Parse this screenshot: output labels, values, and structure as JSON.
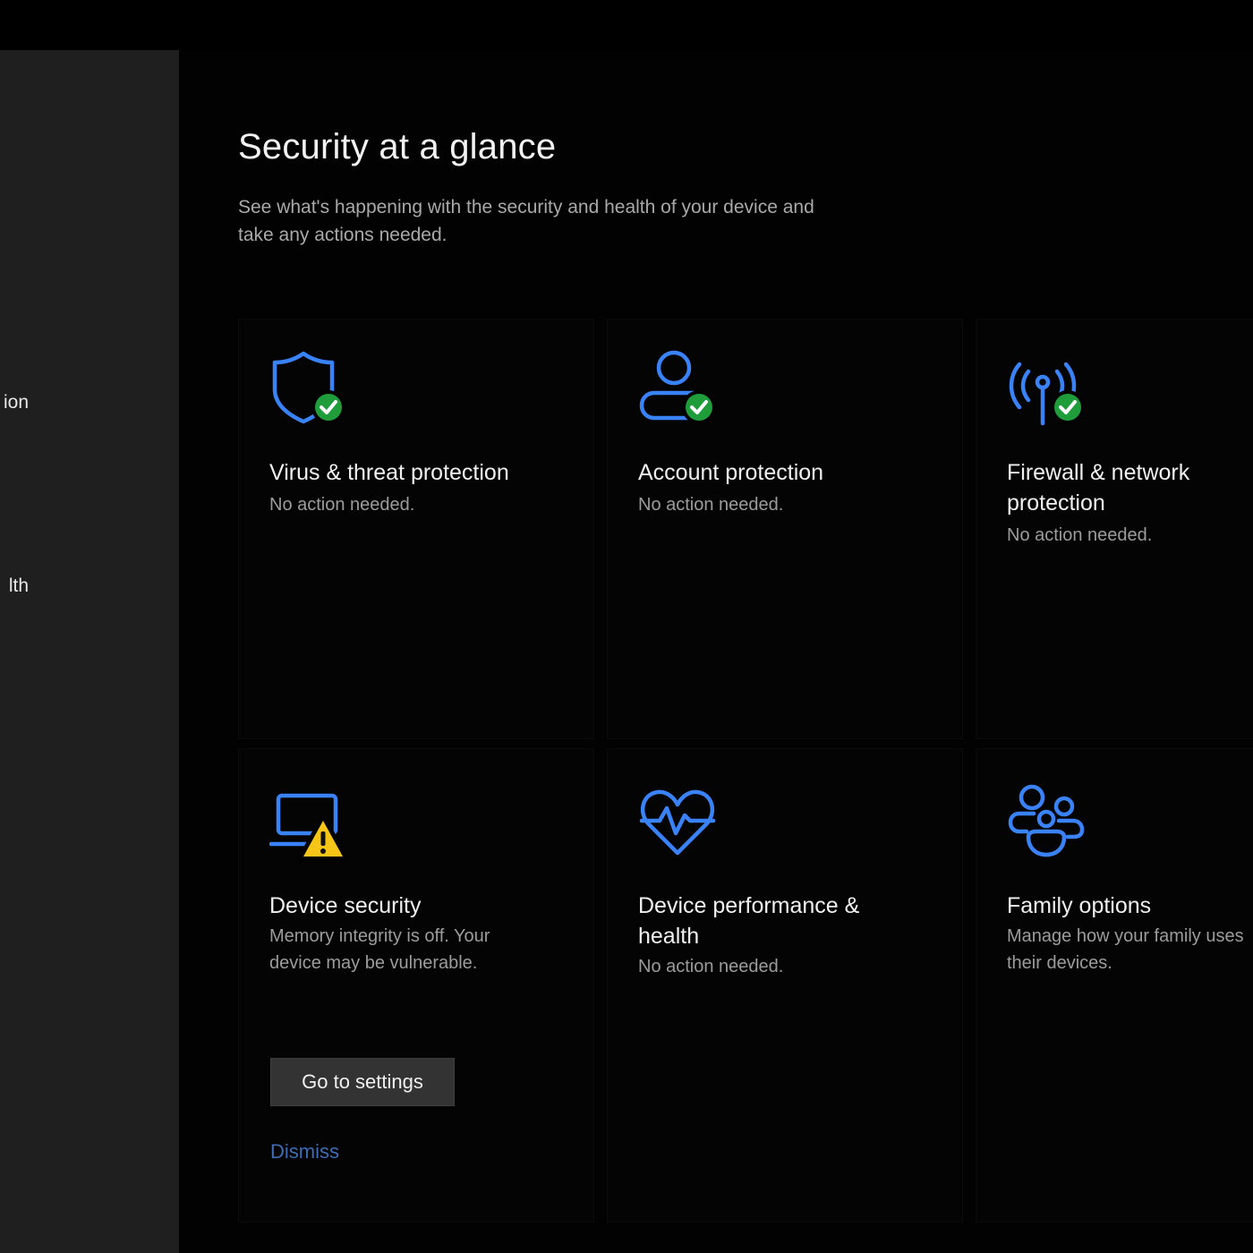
{
  "sidebar": {
    "items": [
      {
        "label": "ion"
      },
      {
        "label": "lth"
      }
    ]
  },
  "main": {
    "title": "Security at a glance",
    "subtitle": "See what's happening with the security and health of your device and take any actions needed."
  },
  "tiles": [
    {
      "title": "Virus & threat protection",
      "status": "No action needed.",
      "icon": "shield-icon",
      "badge": "check"
    },
    {
      "title": "Account protection",
      "status": "No action needed.",
      "icon": "person-icon",
      "badge": "check"
    },
    {
      "title": "Firewall & network protection",
      "status": "No action needed.",
      "icon": "antenna-icon",
      "badge": "check"
    },
    {
      "title": "Device security",
      "status": "Memory integrity is off. Your device may be vulnerable.",
      "icon": "laptop-icon",
      "badge": "warning",
      "action_label": "Go to settings",
      "dismiss_label": "Dismiss"
    },
    {
      "title": "Device performance & health",
      "status": "No action needed.",
      "icon": "heart-pulse-icon",
      "badge": "none"
    },
    {
      "title": "Family options",
      "status": "Manage how your family uses their devices.",
      "icon": "family-icon",
      "badge": "none"
    }
  ],
  "colors": {
    "icon_blue": "#3a82f7",
    "ok_green": "#1f9d3a",
    "warning_yellow": "#f5c518",
    "link_blue": "#3f6db5"
  }
}
